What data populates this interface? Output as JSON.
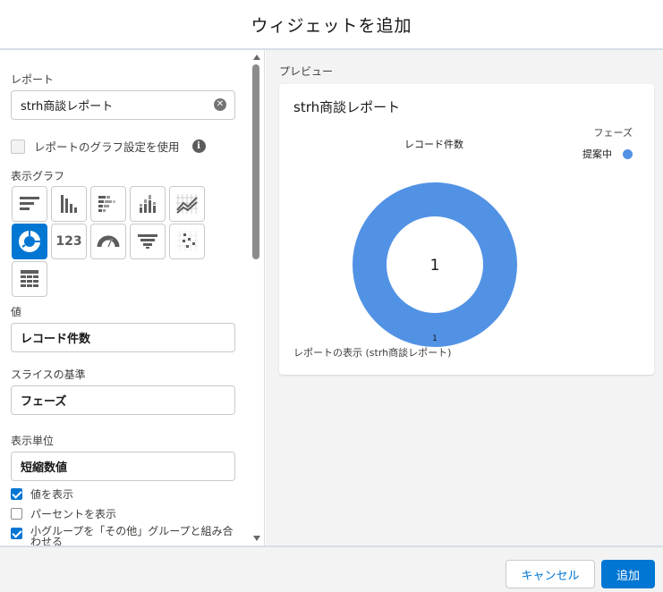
{
  "modal": {
    "title": "ウィジェットを追加"
  },
  "form": {
    "report_label": "レポート",
    "report_value": "strh商談レポート",
    "use_report_chart_label": "レポートのグラフ設定を使用",
    "chart_type_label": "表示グラフ",
    "chart_types": [
      "horizontal-bar",
      "vertical-bar",
      "stacked-horizontal-bar",
      "stacked-vertical-bar",
      "line",
      "donut",
      "metric",
      "gauge",
      "funnel",
      "scatter",
      "table"
    ],
    "chart_type_metric_text": "123",
    "selected_chart_type": "donut",
    "value_label": "値",
    "value_value": "レコード件数",
    "slice_label": "スライスの基準",
    "slice_value": "フェーズ",
    "unit_label": "表示単位",
    "unit_value": "短縮数値",
    "show_values_label": "値を表示",
    "show_values_checked": true,
    "show_percent_label": "パーセントを表示",
    "show_percent_checked": false,
    "combine_groups_label": "小グループを「その他」グループと組み合わせる",
    "combine_groups_checked": true
  },
  "preview": {
    "label": "プレビュー",
    "card_title": "strh商談レポート",
    "chart_title": "レコード件数",
    "legend_title": "フェーズ",
    "footer_link": "レポートの表示 (strh商談レポート)"
  },
  "chart_data": {
    "type": "pie",
    "title": "レコード件数",
    "categories": [
      "提案中"
    ],
    "values": [
      1
    ],
    "center_total": "1",
    "data_labels": [
      "1"
    ],
    "legend_title": "フェーズ",
    "legend_position": "top-right",
    "colors": [
      "#5192e5"
    ]
  },
  "actions": {
    "cancel_label": "キャンセル",
    "add_label": "追加"
  },
  "colors": {
    "brand": "#0176d3",
    "slice": "#5192e5"
  }
}
